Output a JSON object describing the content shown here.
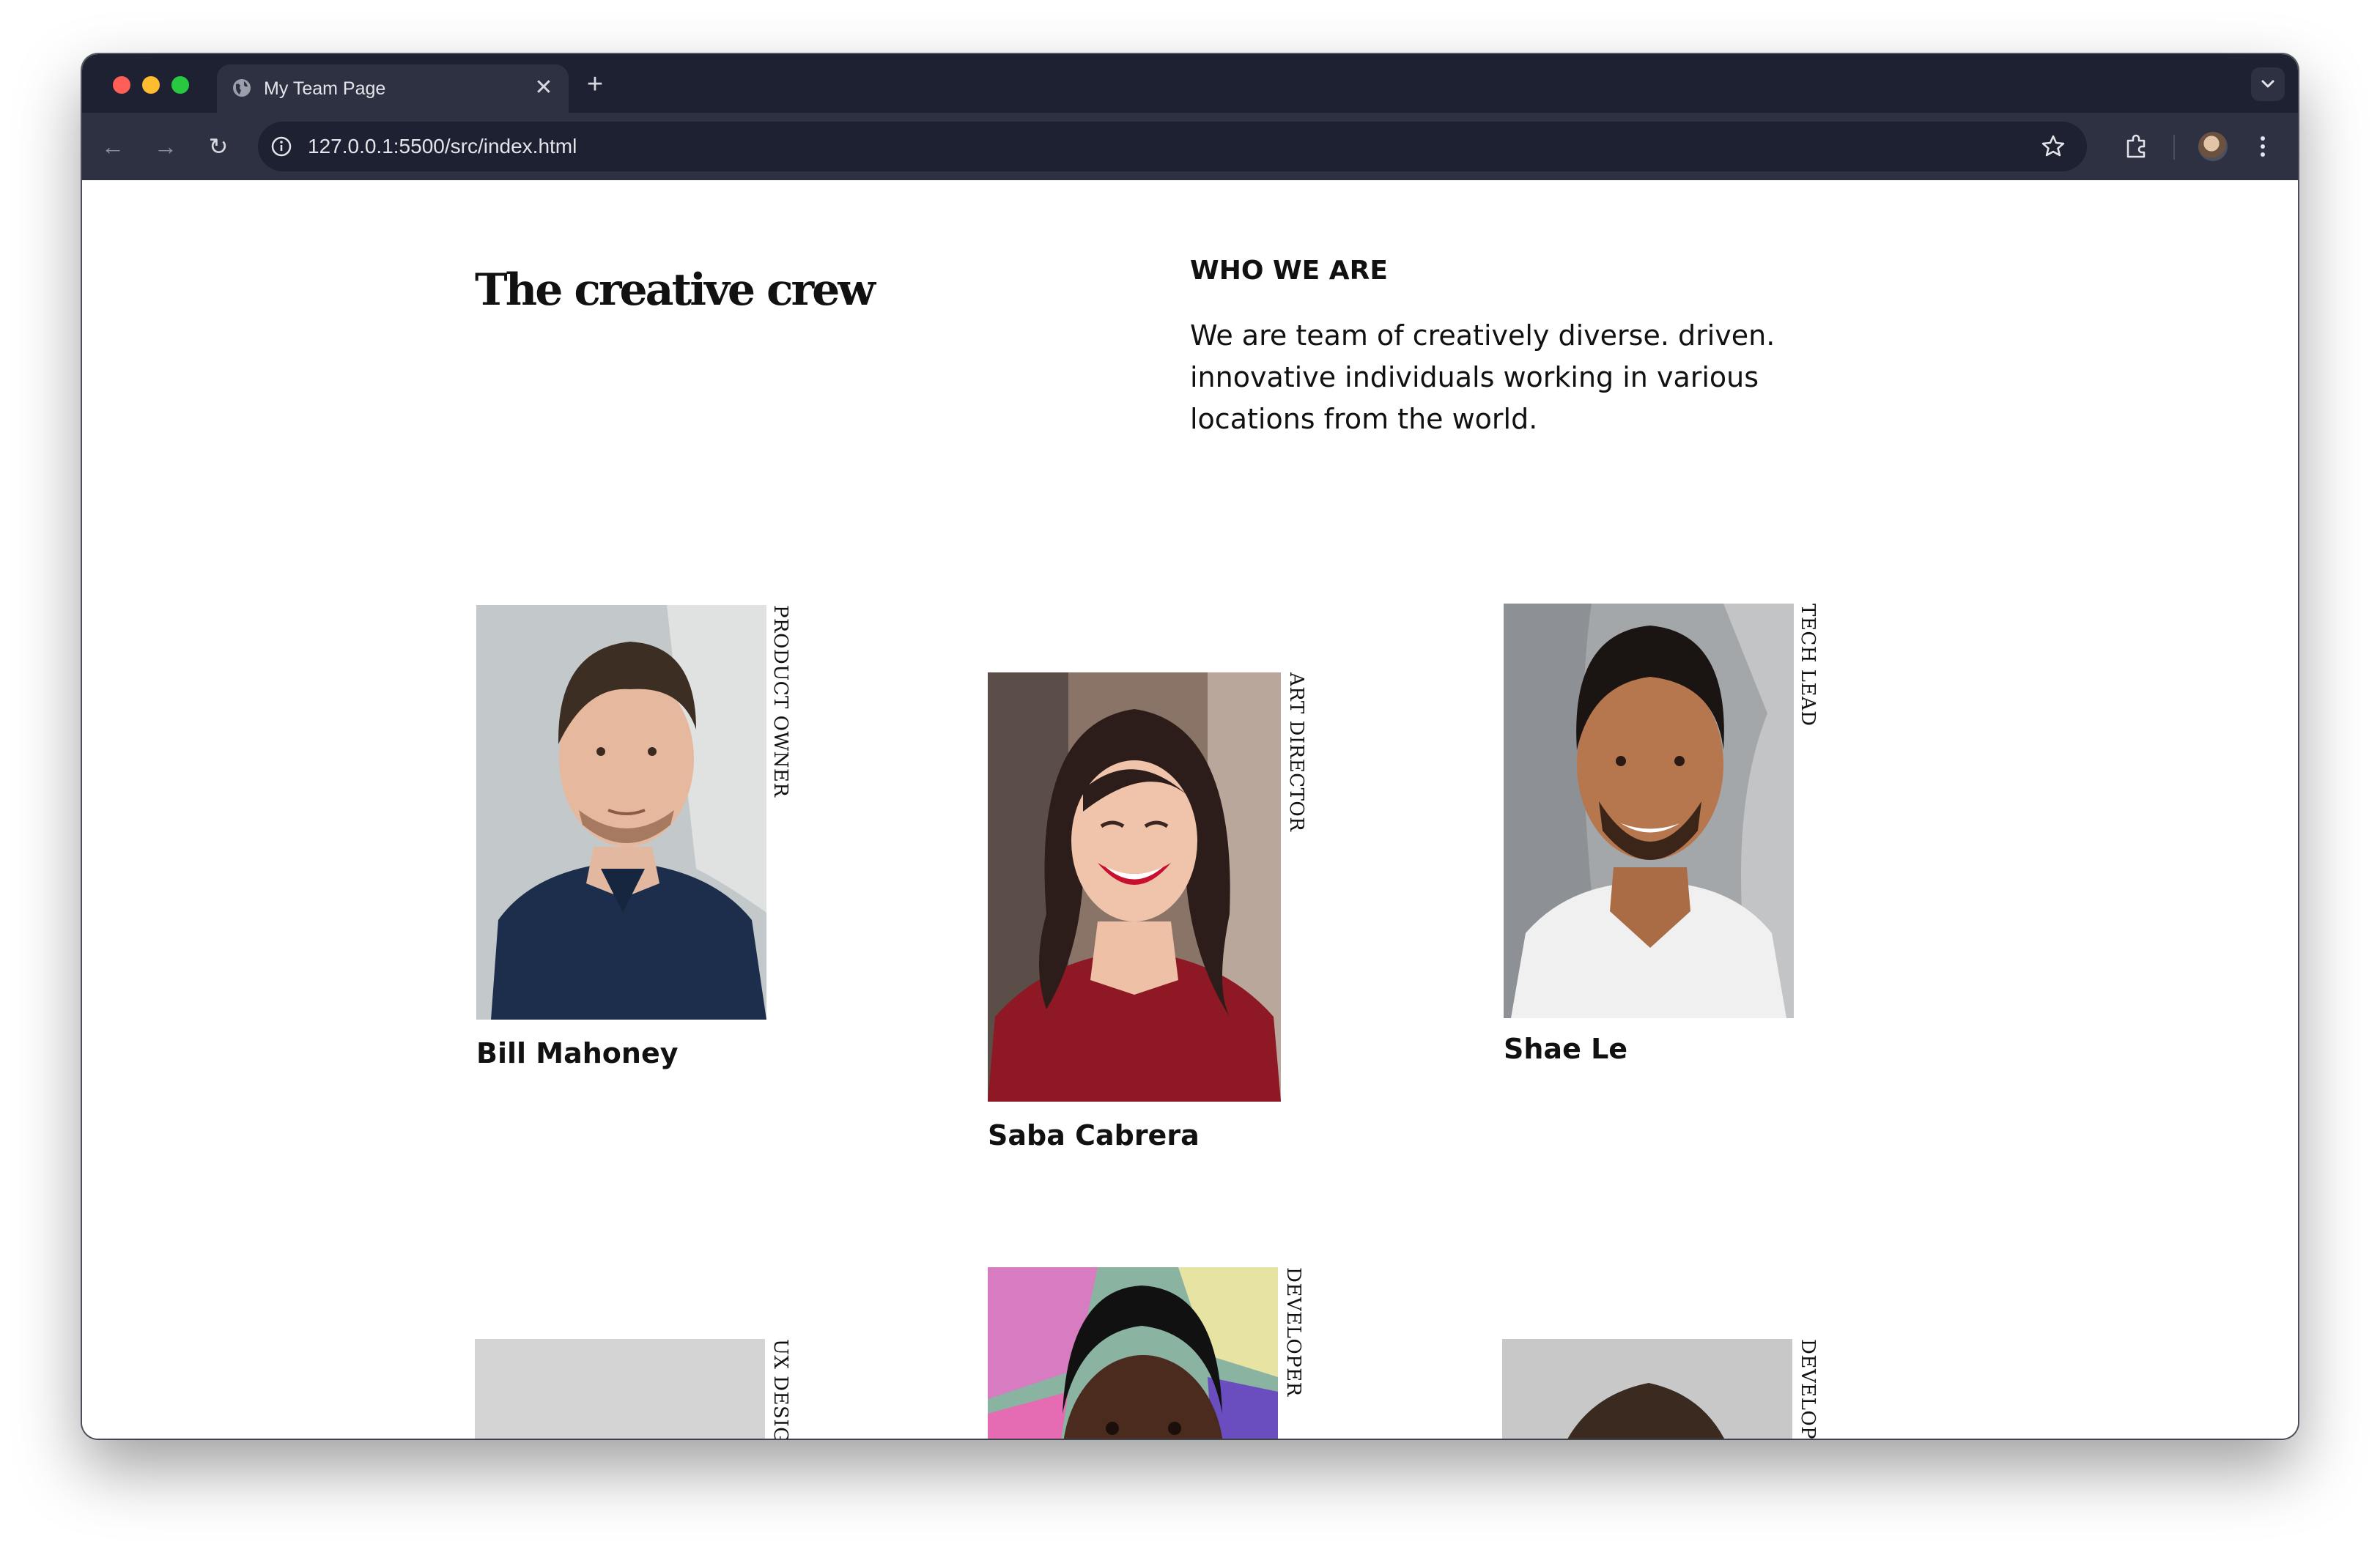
{
  "browser": {
    "tab_title": "My Team Page",
    "tab_close": "✕",
    "new_tab": "+",
    "url": "127.0.0.1:5500/src/index.html",
    "back": "←",
    "forward": "→",
    "reload": "↻"
  },
  "page": {
    "headline": "The creative crew",
    "kicker": "WHO WE ARE",
    "intro": "We are team of creatively diverse. driven. innovative individuals working in various locations from the world."
  },
  "team": [
    {
      "name": "Bill Mahoney",
      "role": "PRODUCT OWNER"
    },
    {
      "name": "Saba Cabrera",
      "role": "ART DIRECTOR"
    },
    {
      "name": "Shae Le",
      "role": "TECH LEAD"
    },
    {
      "name": "",
      "role": "UX DESIGNER"
    },
    {
      "name": "",
      "role": "DEVELOPER"
    },
    {
      "name": "",
      "role": "DEVELOPER"
    }
  ],
  "colors": {
    "chrome_dark": "#1d2131",
    "chrome_mid": "#2d3142",
    "text": "#111111",
    "background": "#ffffff"
  }
}
